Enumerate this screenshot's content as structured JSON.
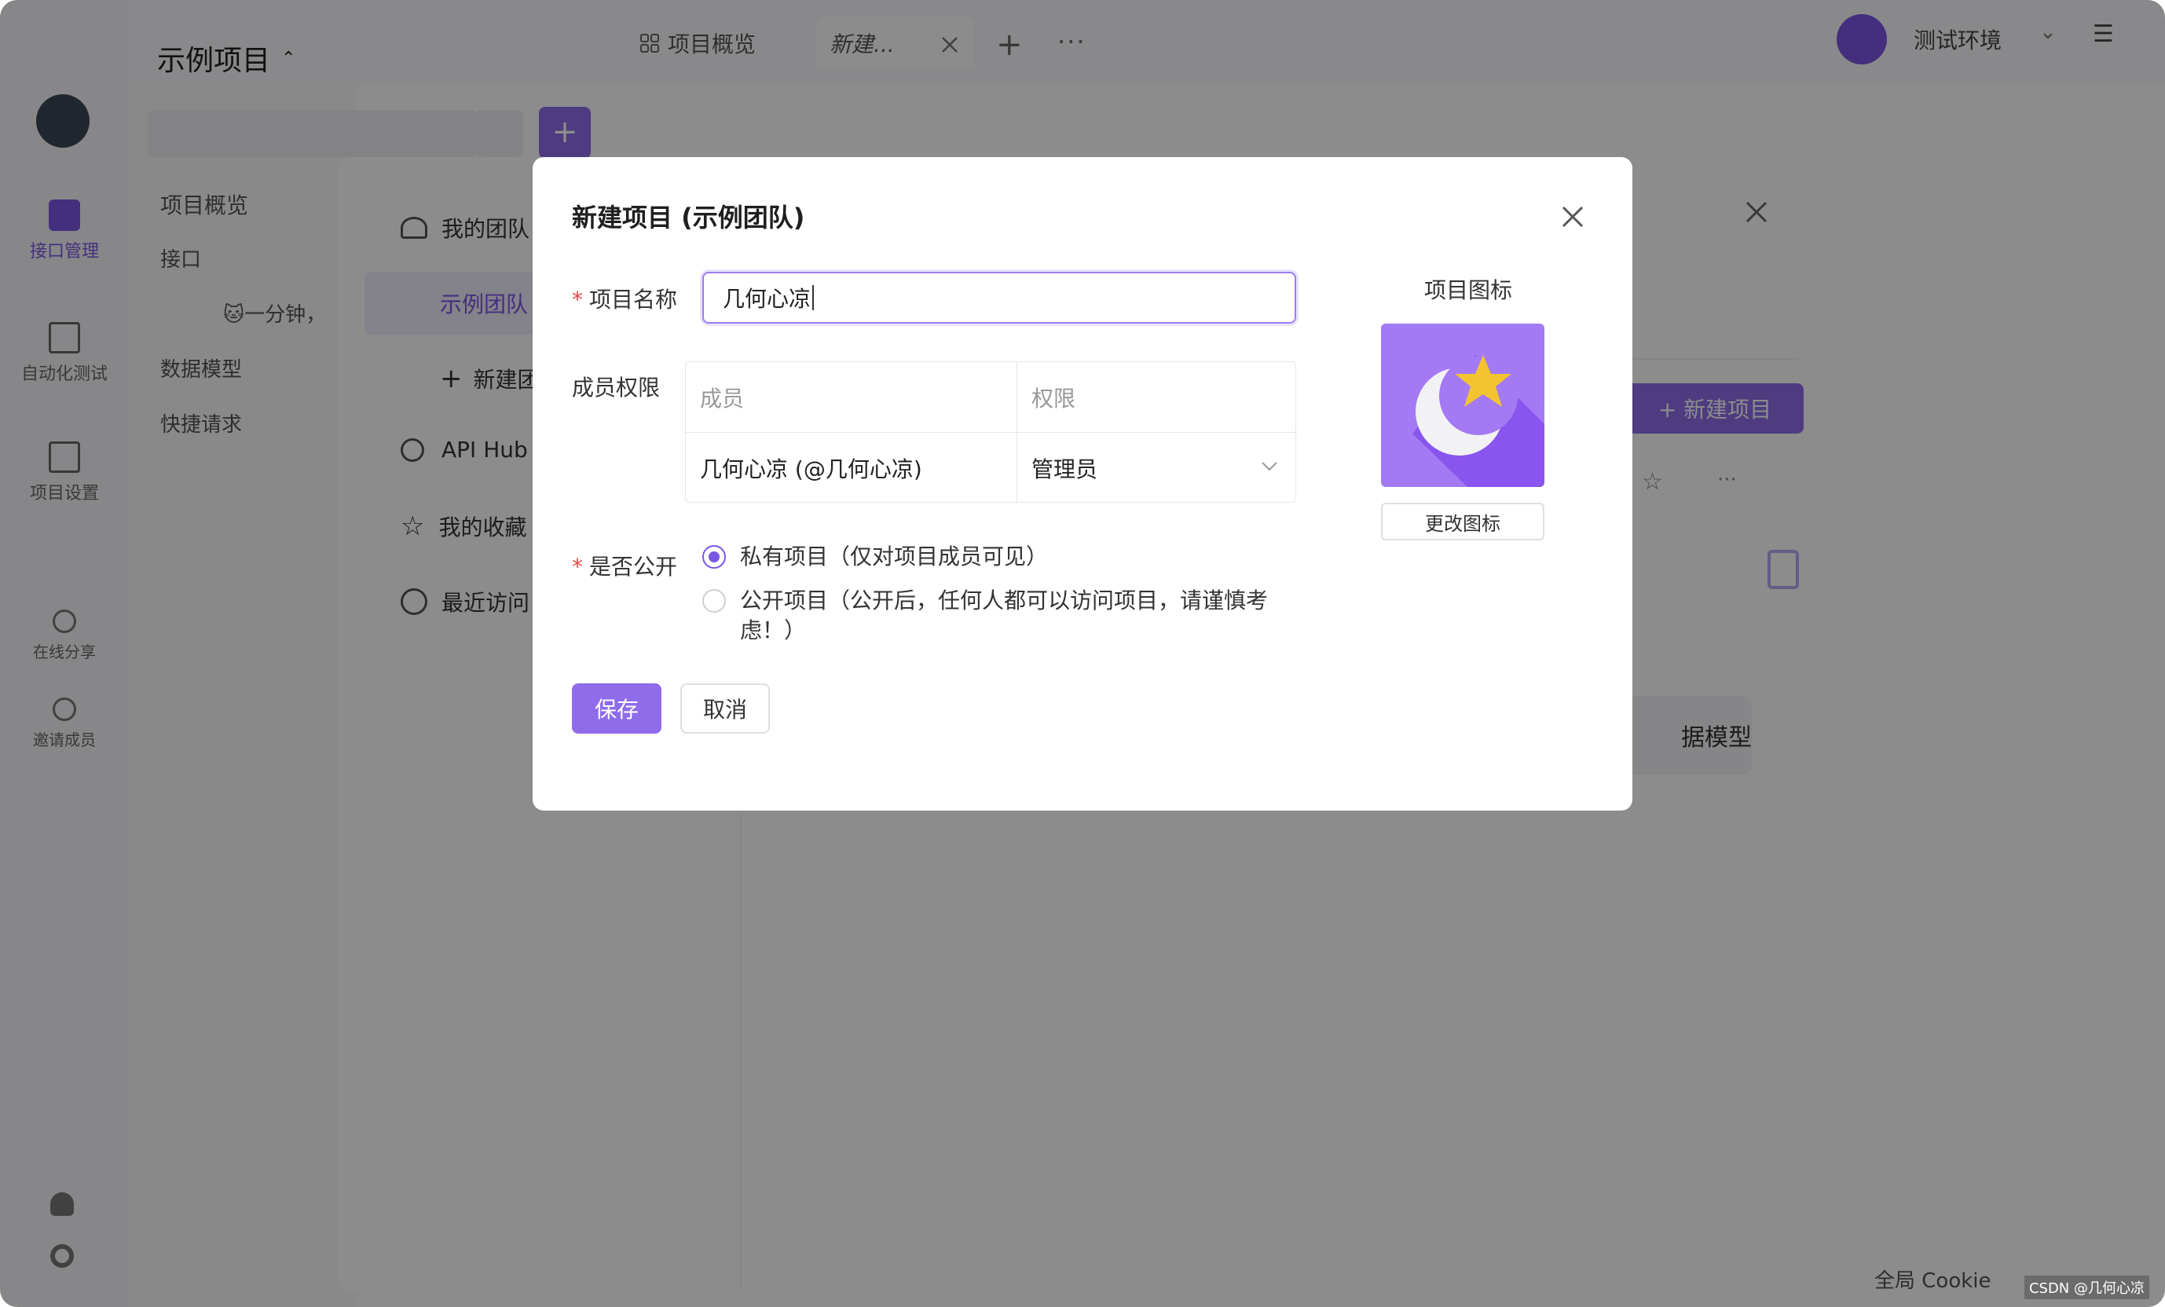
{
  "app": {
    "project_switcher": "示例项目",
    "tabs": [
      {
        "label": "项目概览"
      },
      {
        "label": "新建..."
      }
    ],
    "env_label": "测试环境"
  },
  "left_nav": [
    {
      "label": "接口管理"
    },
    {
      "label": "自动化测试"
    },
    {
      "label": "项目设置"
    },
    {
      "label": "在线分享"
    },
    {
      "label": "邀请成员"
    }
  ],
  "side_panel": {
    "overview": "项目概览",
    "api_group": "接口",
    "api_item": "🐱一分钟，",
    "data_model": "数据模型",
    "quick_request": "快捷请求"
  },
  "underlying_modal": {
    "items": [
      {
        "label": "我的团队"
      },
      {
        "label": "示例团队"
      },
      {
        "label": "新建团队"
      },
      {
        "label": "API Hub"
      },
      {
        "label": "我的收藏"
      },
      {
        "label": "最近访问"
      }
    ],
    "new_project_button": "+ 新建项目",
    "data_model_card": "据模型"
  },
  "footer": {
    "cookie": "全局 Cookie",
    "watermark": "CSDN @几何心凉"
  },
  "dialog": {
    "title": "新建项目 (示例团队)",
    "name_label": "项目名称",
    "name_value": "几何心凉",
    "members_label": "成员权限",
    "table_headers": [
      "成员",
      "权限"
    ],
    "member_row": {
      "member": "几何心凉 (@几何心凉)",
      "role": "管理员"
    },
    "public_label": "是否公开",
    "options": [
      {
        "label": "私有项目（仅对项目成员可见）",
        "selected": true
      },
      {
        "label": "公开项目（公开后，任何人都可以访问项目，请谨慎考虑！）",
        "selected": false
      }
    ],
    "save": "保存",
    "cancel": "取消",
    "icon_title": "项目图标",
    "change_icon": "更改图标",
    "icon_name": "moon-star-icon"
  },
  "colors": {
    "accent": "#8e6cea",
    "icon_bg": "#a37af3",
    "required": "#e5484d"
  }
}
